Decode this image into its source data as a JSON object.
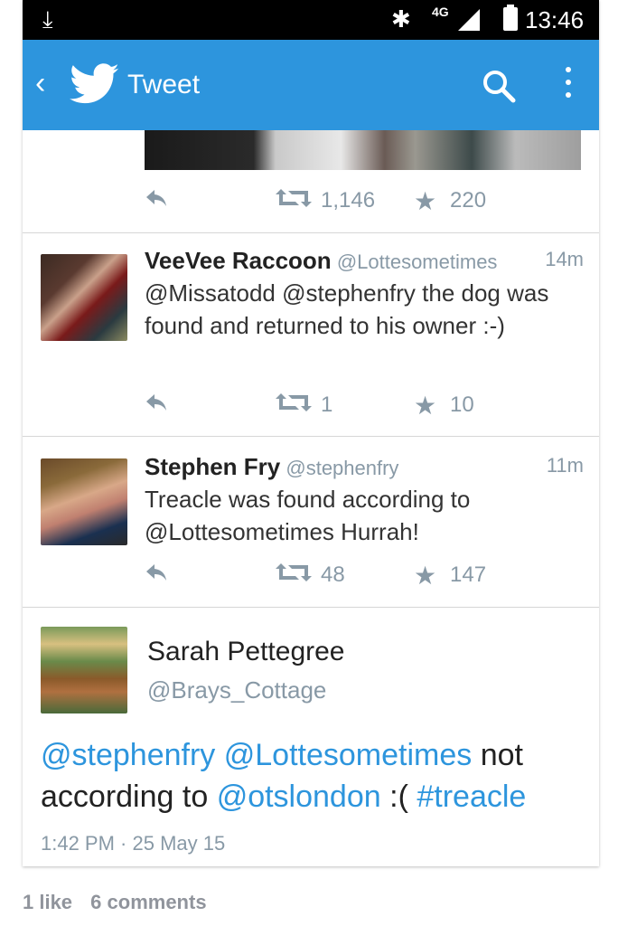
{
  "status_bar": {
    "network": "4G",
    "time": "13:46"
  },
  "app_bar": {
    "title": "Tweet"
  },
  "tweets": [
    {
      "retweets": "1,146",
      "favorites": "220"
    },
    {
      "name": "VeeVee Raccoon",
      "handle": "@Lottesometimes",
      "time": "14m",
      "text": "@Missatodd @stephenfry the dog was found and returned to his owner :-)",
      "retweets": "1",
      "favorites": "10"
    },
    {
      "name": "Stephen Fry",
      "handle": "@stephenfry",
      "time": "11m",
      "text": "Treacle was found according to @Lottesometimes Hurrah!",
      "retweets": "48",
      "favorites": "147"
    }
  ],
  "main_tweet": {
    "name": "Sarah Pettegree",
    "handle": "@Brays_Cottage",
    "text_parts": [
      "@stephenfry",
      "@Lottesometimes",
      "not according to",
      "@otslondon",
      ":(",
      "#treacle"
    ],
    "timestamp": "1:42 PM · 25 May 15"
  },
  "post_stats": {
    "likes": "1 like",
    "comments": "6 comments"
  },
  "colors": {
    "brand": "#2d95dd",
    "muted": "#8899a6"
  },
  "icons": [
    "download-icon",
    "bluetooth-icon",
    "signal-icon",
    "battery-icon",
    "back-icon",
    "twitter-bird-icon",
    "search-icon",
    "more-icon",
    "reply-icon",
    "retweet-icon",
    "star-icon"
  ]
}
